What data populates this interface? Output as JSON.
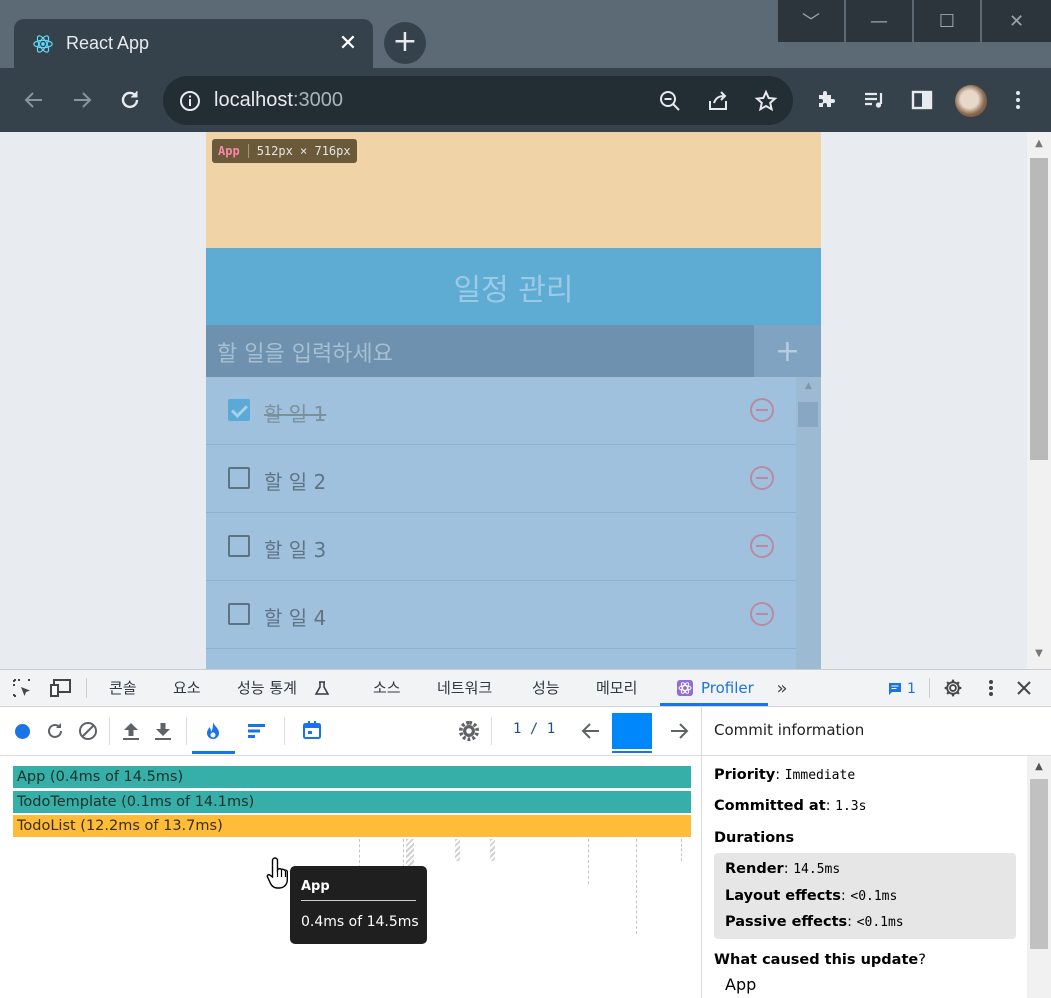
{
  "browser": {
    "tab_title": "React App",
    "tab_close": "✕",
    "new_tab": "+",
    "url_host": "localhost",
    "url_port": ":3000",
    "window_controls": [
      "﹀",
      "—",
      "☐",
      "✕"
    ]
  },
  "page": {
    "badge": {
      "name": "App",
      "size": "512px × 716px"
    },
    "title": "일정 관리",
    "input_placeholder": "할 일을 입력하세요",
    "add_label": "+",
    "todos": [
      {
        "text": "할 일 1",
        "checked": true
      },
      {
        "text": "할 일 2",
        "checked": false
      },
      {
        "text": "할 일 3",
        "checked": false
      },
      {
        "text": "할 일 4",
        "checked": false
      }
    ]
  },
  "devtools": {
    "tabs": [
      "콘솔",
      "요소",
      "성능 통계",
      "소스",
      "네트워크",
      "성능",
      "메모리",
      "Profiler"
    ],
    "issues_count": "1",
    "commit_nav": "1 / 1",
    "flame": [
      {
        "label": "App (0.4ms of 14.5ms)",
        "color": "#37afa9"
      },
      {
        "label": "TodoTemplate (0.1ms of 14.1ms)",
        "color": "#37afa9"
      },
      {
        "label": "TodoList (12.2ms of 13.7ms)",
        "color": "#febc38"
      }
    ],
    "tooltip": {
      "name": "App",
      "value": "0.4ms of 14.5ms"
    },
    "commit_info": {
      "header": "Commit information",
      "priority_label": "Priority",
      "priority": "Immediate",
      "committed_label": "Committed at",
      "committed": "1.3s",
      "durations_label": "Durations",
      "render_label": "Render",
      "render": "14.5ms",
      "layout_label": "Layout effects",
      "layout": "<0.1ms",
      "passive_label": "Passive effects",
      "passive": "<0.1ms",
      "cause_label": "What caused this update",
      "cause": "App"
    }
  }
}
